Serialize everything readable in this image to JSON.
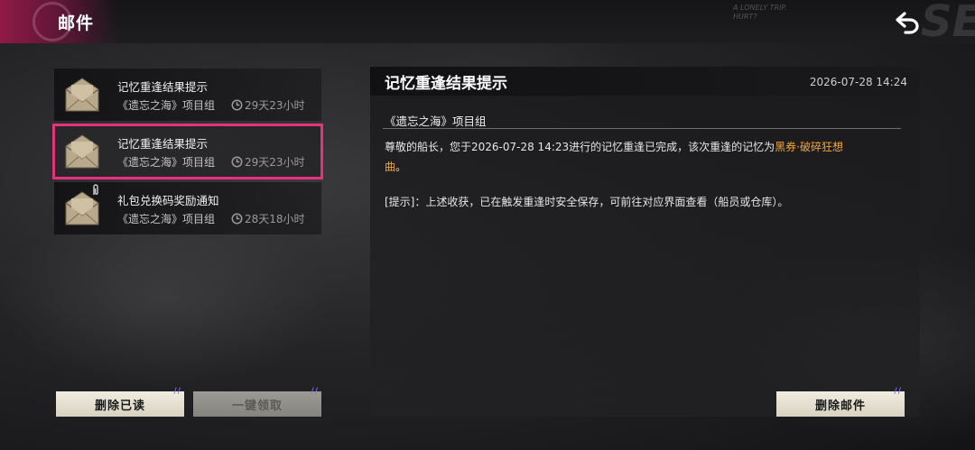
{
  "header": {
    "title": "邮件",
    "deco_text": "A LONELY TRIP. HURT?",
    "deco_big": "SE"
  },
  "mails": [
    {
      "title": "记忆重逢结果提示",
      "sender": "《遗忘之海》项目组",
      "remaining": "29天23小时",
      "attachment": false
    },
    {
      "title": "记忆重逢结果提示",
      "sender": "《遗忘之海》项目组",
      "remaining": "29天23小时",
      "attachment": false,
      "selected": true
    },
    {
      "title": "礼包兑换码奖励通知",
      "sender": "《遗忘之海》项目组",
      "remaining": "28天18小时",
      "attachment": true
    }
  ],
  "buttons": {
    "delete_read": "删除已读",
    "collect_all": "一键领取",
    "delete_mail": "删除邮件"
  },
  "detail": {
    "title": "记忆重逢结果提示",
    "date": "2026-07-28 14:24",
    "sender": "《遗忘之海》项目组",
    "body_prefix": "尊敬的船长，您于2026-07-28 14:23进行的记忆重逢已完成，该次重逢的记忆为",
    "body_highlight": "黑券·破碎狂想",
    "body_highlight_2": "曲",
    "body_suffix": "。",
    "tip": "[提示]：上述收获，已在触发重逢时安全保存，可前往对应界面查看（船员或仓库）。"
  },
  "colors": {
    "accent": "#e8317c",
    "highlight": "#f2a531",
    "button_bg": "#e6e1d2"
  },
  "icons": {
    "back": "back-arrow-icon",
    "envelope": "envelope-icon",
    "clock": "clock-icon",
    "attachment": "paperclip-icon"
  }
}
